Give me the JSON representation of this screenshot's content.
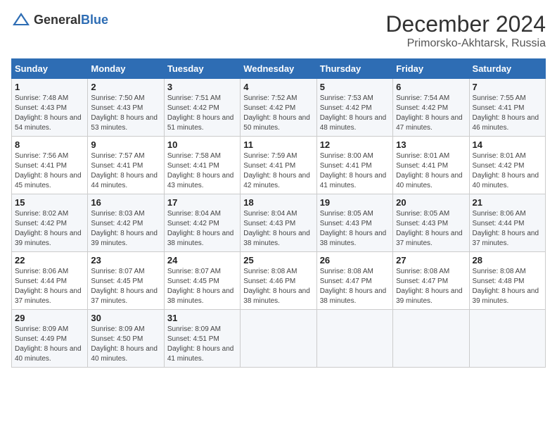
{
  "header": {
    "logo_general": "General",
    "logo_blue": "Blue",
    "month_title": "December 2024",
    "location": "Primorsko-Akhtarsk, Russia"
  },
  "days_of_week": [
    "Sunday",
    "Monday",
    "Tuesday",
    "Wednesday",
    "Thursday",
    "Friday",
    "Saturday"
  ],
  "weeks": [
    [
      {
        "day": 1,
        "sunrise": "Sunrise: 7:48 AM",
        "sunset": "Sunset: 4:43 PM",
        "daylight": "Daylight: 8 hours and 54 minutes."
      },
      {
        "day": 2,
        "sunrise": "Sunrise: 7:50 AM",
        "sunset": "Sunset: 4:43 PM",
        "daylight": "Daylight: 8 hours and 53 minutes."
      },
      {
        "day": 3,
        "sunrise": "Sunrise: 7:51 AM",
        "sunset": "Sunset: 4:42 PM",
        "daylight": "Daylight: 8 hours and 51 minutes."
      },
      {
        "day": 4,
        "sunrise": "Sunrise: 7:52 AM",
        "sunset": "Sunset: 4:42 PM",
        "daylight": "Daylight: 8 hours and 50 minutes."
      },
      {
        "day": 5,
        "sunrise": "Sunrise: 7:53 AM",
        "sunset": "Sunset: 4:42 PM",
        "daylight": "Daylight: 8 hours and 48 minutes."
      },
      {
        "day": 6,
        "sunrise": "Sunrise: 7:54 AM",
        "sunset": "Sunset: 4:42 PM",
        "daylight": "Daylight: 8 hours and 47 minutes."
      },
      {
        "day": 7,
        "sunrise": "Sunrise: 7:55 AM",
        "sunset": "Sunset: 4:41 PM",
        "daylight": "Daylight: 8 hours and 46 minutes."
      }
    ],
    [
      {
        "day": 8,
        "sunrise": "Sunrise: 7:56 AM",
        "sunset": "Sunset: 4:41 PM",
        "daylight": "Daylight: 8 hours and 45 minutes."
      },
      {
        "day": 9,
        "sunrise": "Sunrise: 7:57 AM",
        "sunset": "Sunset: 4:41 PM",
        "daylight": "Daylight: 8 hours and 44 minutes."
      },
      {
        "day": 10,
        "sunrise": "Sunrise: 7:58 AM",
        "sunset": "Sunset: 4:41 PM",
        "daylight": "Daylight: 8 hours and 43 minutes."
      },
      {
        "day": 11,
        "sunrise": "Sunrise: 7:59 AM",
        "sunset": "Sunset: 4:41 PM",
        "daylight": "Daylight: 8 hours and 42 minutes."
      },
      {
        "day": 12,
        "sunrise": "Sunrise: 8:00 AM",
        "sunset": "Sunset: 4:41 PM",
        "daylight": "Daylight: 8 hours and 41 minutes."
      },
      {
        "day": 13,
        "sunrise": "Sunrise: 8:01 AM",
        "sunset": "Sunset: 4:41 PM",
        "daylight": "Daylight: 8 hours and 40 minutes."
      },
      {
        "day": 14,
        "sunrise": "Sunrise: 8:01 AM",
        "sunset": "Sunset: 4:42 PM",
        "daylight": "Daylight: 8 hours and 40 minutes."
      }
    ],
    [
      {
        "day": 15,
        "sunrise": "Sunrise: 8:02 AM",
        "sunset": "Sunset: 4:42 PM",
        "daylight": "Daylight: 8 hours and 39 minutes."
      },
      {
        "day": 16,
        "sunrise": "Sunrise: 8:03 AM",
        "sunset": "Sunset: 4:42 PM",
        "daylight": "Daylight: 8 hours and 39 minutes."
      },
      {
        "day": 17,
        "sunrise": "Sunrise: 8:04 AM",
        "sunset": "Sunset: 4:42 PM",
        "daylight": "Daylight: 8 hours and 38 minutes."
      },
      {
        "day": 18,
        "sunrise": "Sunrise: 8:04 AM",
        "sunset": "Sunset: 4:43 PM",
        "daylight": "Daylight: 8 hours and 38 minutes."
      },
      {
        "day": 19,
        "sunrise": "Sunrise: 8:05 AM",
        "sunset": "Sunset: 4:43 PM",
        "daylight": "Daylight: 8 hours and 38 minutes."
      },
      {
        "day": 20,
        "sunrise": "Sunrise: 8:05 AM",
        "sunset": "Sunset: 4:43 PM",
        "daylight": "Daylight: 8 hours and 37 minutes."
      },
      {
        "day": 21,
        "sunrise": "Sunrise: 8:06 AM",
        "sunset": "Sunset: 4:44 PM",
        "daylight": "Daylight: 8 hours and 37 minutes."
      }
    ],
    [
      {
        "day": 22,
        "sunrise": "Sunrise: 8:06 AM",
        "sunset": "Sunset: 4:44 PM",
        "daylight": "Daylight: 8 hours and 37 minutes."
      },
      {
        "day": 23,
        "sunrise": "Sunrise: 8:07 AM",
        "sunset": "Sunset: 4:45 PM",
        "daylight": "Daylight: 8 hours and 37 minutes."
      },
      {
        "day": 24,
        "sunrise": "Sunrise: 8:07 AM",
        "sunset": "Sunset: 4:45 PM",
        "daylight": "Daylight: 8 hours and 38 minutes."
      },
      {
        "day": 25,
        "sunrise": "Sunrise: 8:08 AM",
        "sunset": "Sunset: 4:46 PM",
        "daylight": "Daylight: 8 hours and 38 minutes."
      },
      {
        "day": 26,
        "sunrise": "Sunrise: 8:08 AM",
        "sunset": "Sunset: 4:47 PM",
        "daylight": "Daylight: 8 hours and 38 minutes."
      },
      {
        "day": 27,
        "sunrise": "Sunrise: 8:08 AM",
        "sunset": "Sunset: 4:47 PM",
        "daylight": "Daylight: 8 hours and 39 minutes."
      },
      {
        "day": 28,
        "sunrise": "Sunrise: 8:08 AM",
        "sunset": "Sunset: 4:48 PM",
        "daylight": "Daylight: 8 hours and 39 minutes."
      }
    ],
    [
      {
        "day": 29,
        "sunrise": "Sunrise: 8:09 AM",
        "sunset": "Sunset: 4:49 PM",
        "daylight": "Daylight: 8 hours and 40 minutes."
      },
      {
        "day": 30,
        "sunrise": "Sunrise: 8:09 AM",
        "sunset": "Sunset: 4:50 PM",
        "daylight": "Daylight: 8 hours and 40 minutes."
      },
      {
        "day": 31,
        "sunrise": "Sunrise: 8:09 AM",
        "sunset": "Sunset: 4:51 PM",
        "daylight": "Daylight: 8 hours and 41 minutes."
      },
      null,
      null,
      null,
      null
    ]
  ]
}
